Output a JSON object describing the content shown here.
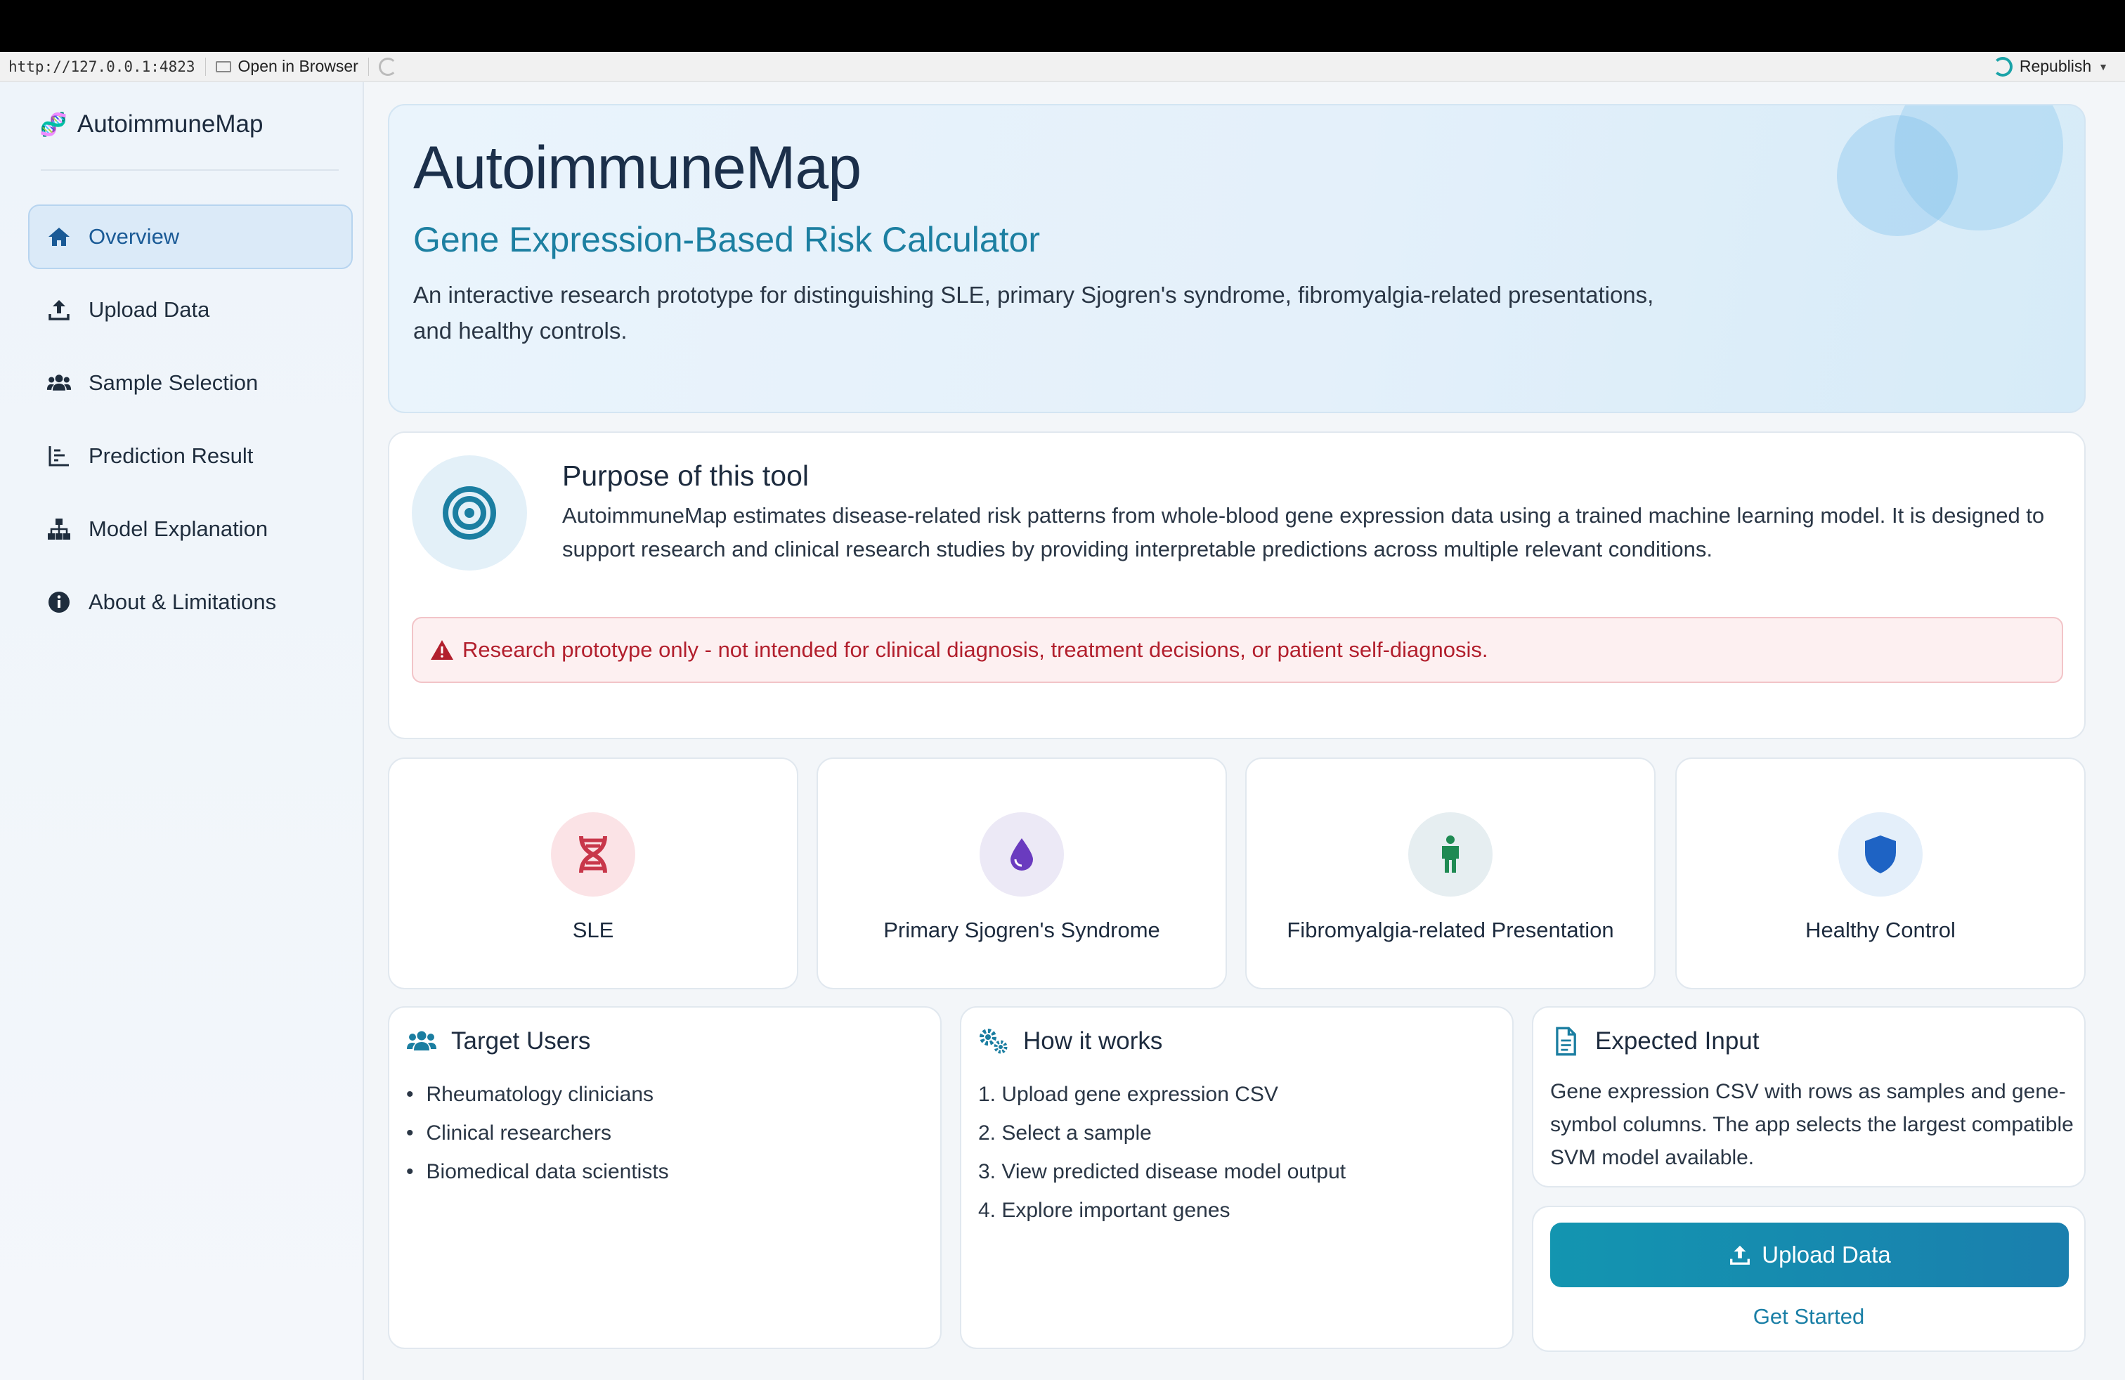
{
  "browser": {
    "url": "http://127.0.0.1:4823",
    "open_label": "Open in Browser",
    "republish_label": "Republish"
  },
  "sidebar": {
    "brand": "AutoimmuneMap",
    "items": [
      {
        "label": "Overview",
        "icon": "home-icon",
        "active": true
      },
      {
        "label": "Upload Data",
        "icon": "upload-icon"
      },
      {
        "label": "Sample Selection",
        "icon": "users-icon"
      },
      {
        "label": "Prediction Result",
        "icon": "chart-icon"
      },
      {
        "label": "Model Explanation",
        "icon": "sitemap-icon"
      },
      {
        "label": "About & Limitations",
        "icon": "info-icon"
      }
    ]
  },
  "hero": {
    "title": "AutoimmuneMap",
    "subtitle": "Gene Expression-Based Risk Calculator",
    "description": "An interactive research prototype for distinguishing SLE, primary Sjogren's syndrome, fibromyalgia-related presentations, and healthy controls."
  },
  "purpose": {
    "title": "Purpose of this tool",
    "text": "AutoimmuneMap estimates disease-related risk patterns from whole-blood gene expression data using a trained machine learning model. It is designed to support research and clinical research studies by providing interpretable predictions across multiple relevant conditions.",
    "warning": "Research prototype only - not intended for clinical diagnosis, treatment decisions, or patient self-diagnosis."
  },
  "conditions": [
    {
      "label": "SLE",
      "icon": "dna-icon",
      "color": "#c8374a",
      "bg": "#fbe3e6"
    },
    {
      "label": "Primary Sjogren's Syndrome",
      "icon": "droplet-icon",
      "color": "#6a3bbf",
      "bg": "#ece9f6"
    },
    {
      "label": "Fibromyalgia-related Presentation",
      "icon": "person-icon",
      "color": "#1f8a53",
      "bg": "#e6eef1"
    },
    {
      "label": "Healthy Control",
      "icon": "shield-icon",
      "color": "#1e63c4",
      "bg": "#e4effa"
    }
  ],
  "target_users": {
    "title": "Target Users",
    "items": [
      "Rheumatology clinicians",
      "Clinical researchers",
      "Biomedical data scientists"
    ]
  },
  "how_it_works": {
    "title": "How it works",
    "steps": [
      "1. Upload gene expression CSV",
      "2. Select a sample",
      "3. View predicted disease model output",
      "4. Explore important genes"
    ]
  },
  "expected_input": {
    "title": "Expected Input",
    "text": "Gene expression CSV with rows as samples and gene-symbol columns. The app selects the largest compatible SVM model available."
  },
  "cta": {
    "button": "Upload Data",
    "link": "Get Started"
  }
}
